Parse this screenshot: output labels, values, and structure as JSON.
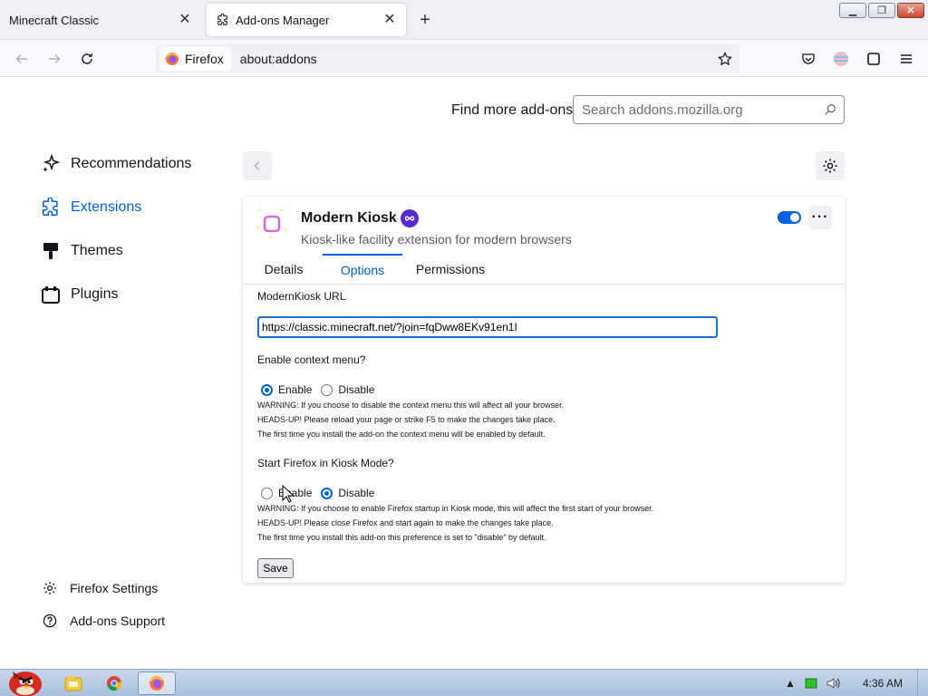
{
  "browser": {
    "tabs": [
      {
        "title": "Minecraft Classic",
        "active": false
      },
      {
        "title": "Add-ons Manager",
        "active": true
      }
    ],
    "identity_label": "Firefox",
    "url": "about:addons"
  },
  "header": {
    "find_more_label": "Find more add-ons",
    "search_placeholder": "Search addons.mozilla.org"
  },
  "sidebar": {
    "categories": [
      {
        "label": "Recommendations",
        "icon": "sparkles-icon",
        "selected": false
      },
      {
        "label": "Extensions",
        "icon": "puzzle-piece-icon",
        "selected": true
      },
      {
        "label": "Themes",
        "icon": "paintbrush-icon",
        "selected": false
      },
      {
        "label": "Plugins",
        "icon": "plugin-icon",
        "selected": false
      }
    ],
    "footer": [
      {
        "label": "Firefox Settings",
        "icon": "gear-icon"
      },
      {
        "label": "Add-ons Support",
        "icon": "help-icon"
      }
    ]
  },
  "addon": {
    "name": "Modern Kiosk",
    "description": "Kiosk-like facility extension for modern browsers",
    "enabled": true,
    "tabs": [
      "Details",
      "Options",
      "Permissions"
    ],
    "selected_tab": "Options",
    "options": {
      "url_label": "ModernKiosk URL",
      "url_value": "https://classic.minecraft.net/?join=fqDww8EKv91en1I",
      "context_menu_label": "Enable context menu?",
      "context_menu_options": [
        "Enable",
        "Disable"
      ],
      "context_menu_selected": "Enable",
      "context_menu_notes": [
        "WARNING: If you choose to disable the context menu this will affect all your browser.",
        "HEADS-UP! Please reload your page or strike F5 to make the changes take place.",
        "The first time you install the add-on the context menu will be enabled by default."
      ],
      "kiosk_mode_label": "Start Firefox in Kiosk Mode?",
      "kiosk_mode_options": [
        "Enable",
        "Disable"
      ],
      "kiosk_mode_selected": "Disable",
      "kiosk_mode_notes": [
        "WARNING: If you choose to enable Firefox startup in Kiosk mode, this will affect the first start of your browser.",
        "HEADS-UP! Please close Firefox and start again to make the changes take place.",
        "The first time you install this add-on this preference is set to \"disable\" by default."
      ],
      "save_label": "Save"
    }
  },
  "taskbar": {
    "clock": "4:36 AM"
  },
  "colors": {
    "accent": "#0061e0",
    "recommended_badge": "#592acb"
  }
}
